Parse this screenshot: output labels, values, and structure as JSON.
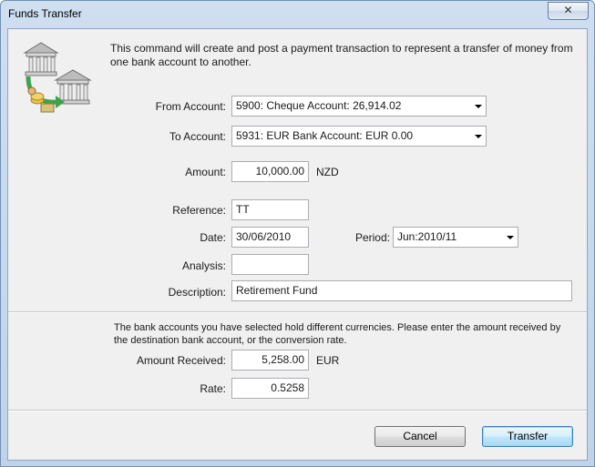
{
  "window": {
    "title": "Funds Transfer",
    "close_glyph": "✕"
  },
  "intro": {
    "icon": "bank-transfer-icon",
    "text": "This command will create and post a payment transaction to represent a transfer of money from one bank account to another."
  },
  "form": {
    "from_account": {
      "label": "From Account:",
      "value": "5900: Cheque Account: 26,914.02"
    },
    "to_account": {
      "label": "To Account:",
      "value": "5931: EUR Bank Account: EUR 0.00"
    },
    "amount": {
      "label": "Amount:",
      "value": "10,000.00",
      "currency": "NZD"
    },
    "reference": {
      "label": "Reference:",
      "value": "TT"
    },
    "date": {
      "label": "Date:",
      "value": "30/06/2010"
    },
    "period": {
      "label": "Period:",
      "value": "Jun:2010/11"
    },
    "analysis": {
      "label": "Analysis:",
      "value": ""
    },
    "description": {
      "label": "Description:",
      "value": "Retirement Fund"
    }
  },
  "currency_section": {
    "note": "The bank accounts you have selected hold different currencies. Please enter the amount received by the destination bank account, or the conversion rate.",
    "amount_received": {
      "label": "Amount Received:",
      "value": "5,258.00",
      "currency": "EUR"
    },
    "rate": {
      "label": "Rate:",
      "value": "0.5258"
    }
  },
  "buttons": {
    "cancel": "Cancel",
    "transfer": "Transfer"
  },
  "colors": {
    "title_bar": "#cfdff0",
    "dialog_bg": "#f0f0f0",
    "default_button": "#bee6fd"
  }
}
